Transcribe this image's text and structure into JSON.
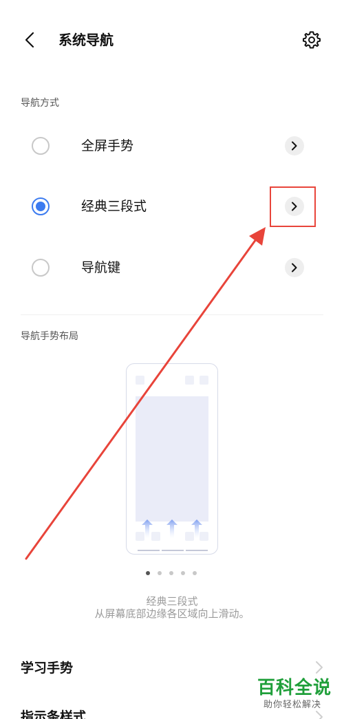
{
  "header": {
    "title": "系统导航"
  },
  "nav_method": {
    "section_label": "导航方式",
    "options": [
      {
        "label": "全屏手势",
        "selected": false
      },
      {
        "label": "经典三段式",
        "selected": true
      },
      {
        "label": "导航键",
        "selected": false
      }
    ]
  },
  "gesture_layout": {
    "section_label": "导航手势布局",
    "pager": {
      "count": 5,
      "active_index": 0
    },
    "caption_title": "经典三段式",
    "caption_desc": "从屏幕底部边缘各区域向上滑动。"
  },
  "list": {
    "items": [
      {
        "label": "学习手势"
      },
      {
        "label": "指示条样式"
      }
    ]
  },
  "watermark": {
    "main": "百科全说",
    "sub": "助你轻松解决"
  },
  "colors": {
    "accent": "#3c7bf0",
    "annotation": "#e8443a",
    "brand": "#1f9f3a"
  }
}
